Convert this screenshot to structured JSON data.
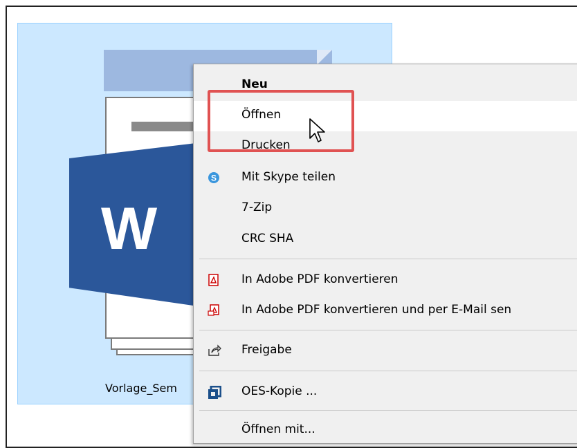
{
  "file": {
    "name": "Vorlage_Sem",
    "icon": "word-document-icon",
    "app_letter": "W",
    "accent": "#2b579a"
  },
  "context_menu": {
    "items": [
      {
        "label": "Neu",
        "bold": true,
        "icon": ""
      },
      {
        "label": "Öffnen",
        "icon": ""
      },
      {
        "label": "Drucken",
        "icon": ""
      },
      {
        "label": "Mit Skype teilen",
        "icon": "skype-icon"
      },
      {
        "label": "7-Zip",
        "icon": ""
      },
      {
        "label": "CRC SHA",
        "icon": ""
      },
      {
        "label": "In Adobe PDF konvertieren",
        "icon": "adobe-pdf-icon"
      },
      {
        "label": "In Adobe PDF konvertieren und per E-Mail sen",
        "icon": "adobe-pdf-mail-icon"
      },
      {
        "label": "Freigabe",
        "icon": "share-icon"
      },
      {
        "label": "OES-Kopie ...",
        "icon": "oes-copy-icon"
      },
      {
        "label": "Öffnen mit...",
        "icon": ""
      }
    ]
  },
  "highlight_color": "#e05252"
}
